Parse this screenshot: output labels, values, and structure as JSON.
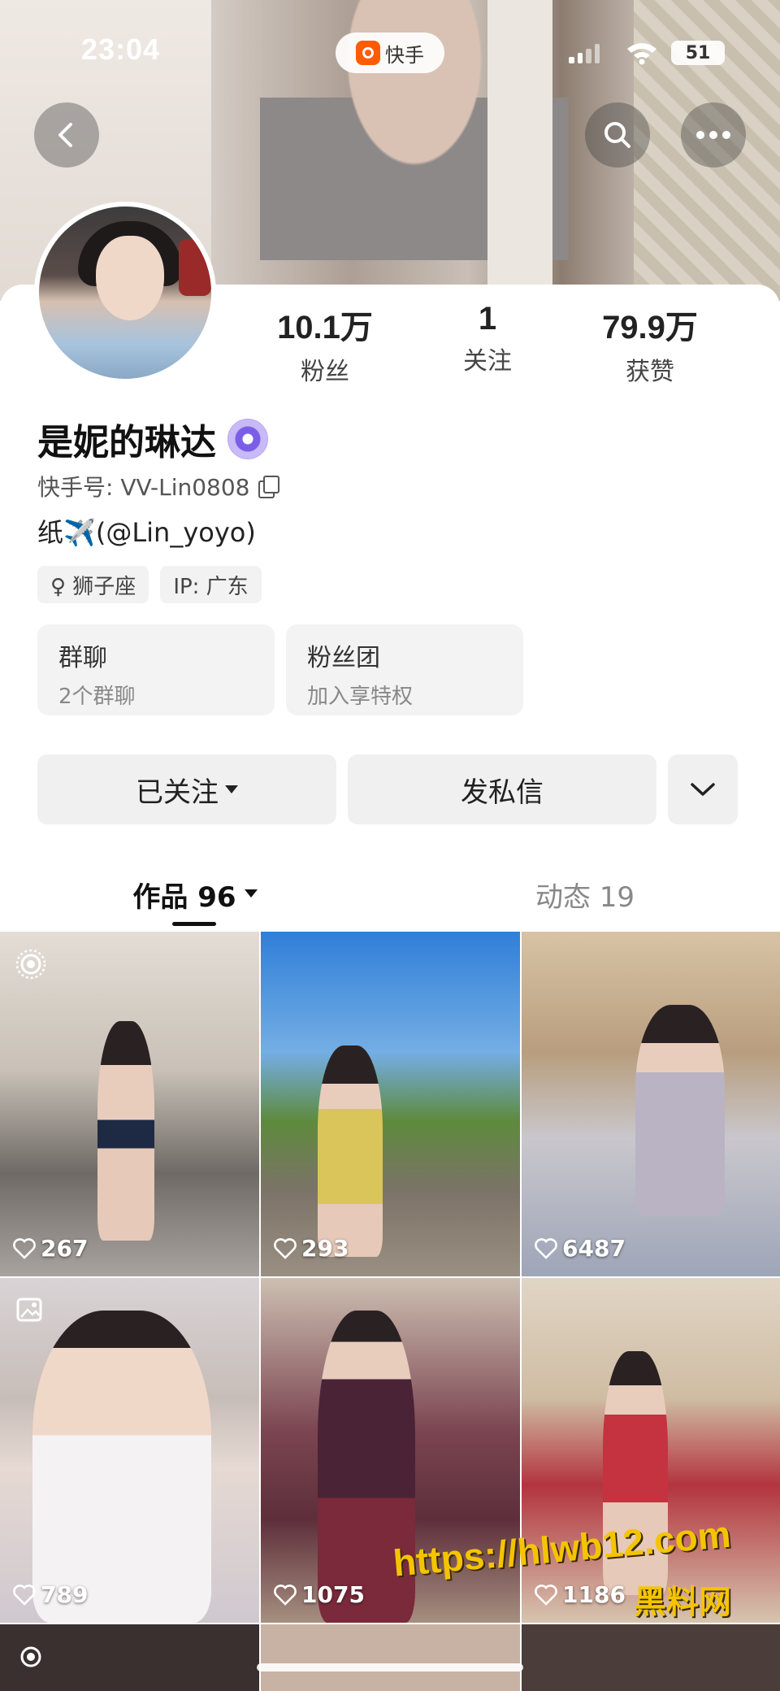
{
  "status_bar": {
    "time": "23:04",
    "app_name": "快手",
    "battery": "51"
  },
  "profile": {
    "nickname": "是妮的琳达",
    "kuaishou_id": "快手号: VV-Lin0808",
    "bio": "纸✈️(@Lin_yoyo)",
    "tags": [
      "♀ 狮子座",
      "IP: 广东"
    ],
    "stats": [
      {
        "value": "10.1万",
        "label": "粉丝"
      },
      {
        "value": "1",
        "label": "关注"
      },
      {
        "value": "79.9万",
        "label": "获赞"
      }
    ]
  },
  "cards": [
    {
      "title": "群聊",
      "subtitle": "2个群聊"
    },
    {
      "title": "粉丝团",
      "subtitle": "加入享特权"
    }
  ],
  "actions": {
    "follow_label": "已关注",
    "message_label": "发私信"
  },
  "tabs": [
    {
      "label": "作品 96",
      "active": true
    },
    {
      "label": "动态 19",
      "active": false
    }
  ],
  "works": [
    {
      "likes": "267",
      "corner": "live-photo-icon"
    },
    {
      "likes": "293",
      "corner": ""
    },
    {
      "likes": "6487",
      "corner": ""
    },
    {
      "likes": "789",
      "corner": "gallery-icon"
    },
    {
      "likes": "1075",
      "corner": ""
    },
    {
      "likes": "1186",
      "corner": ""
    }
  ],
  "watermark": {
    "url": "https://hlwb12.com",
    "name": "黑料网"
  },
  "colors": {
    "accent": "#ff5b00",
    "watermark": "#f5c400",
    "verified_badge": "#7b5ee5"
  }
}
